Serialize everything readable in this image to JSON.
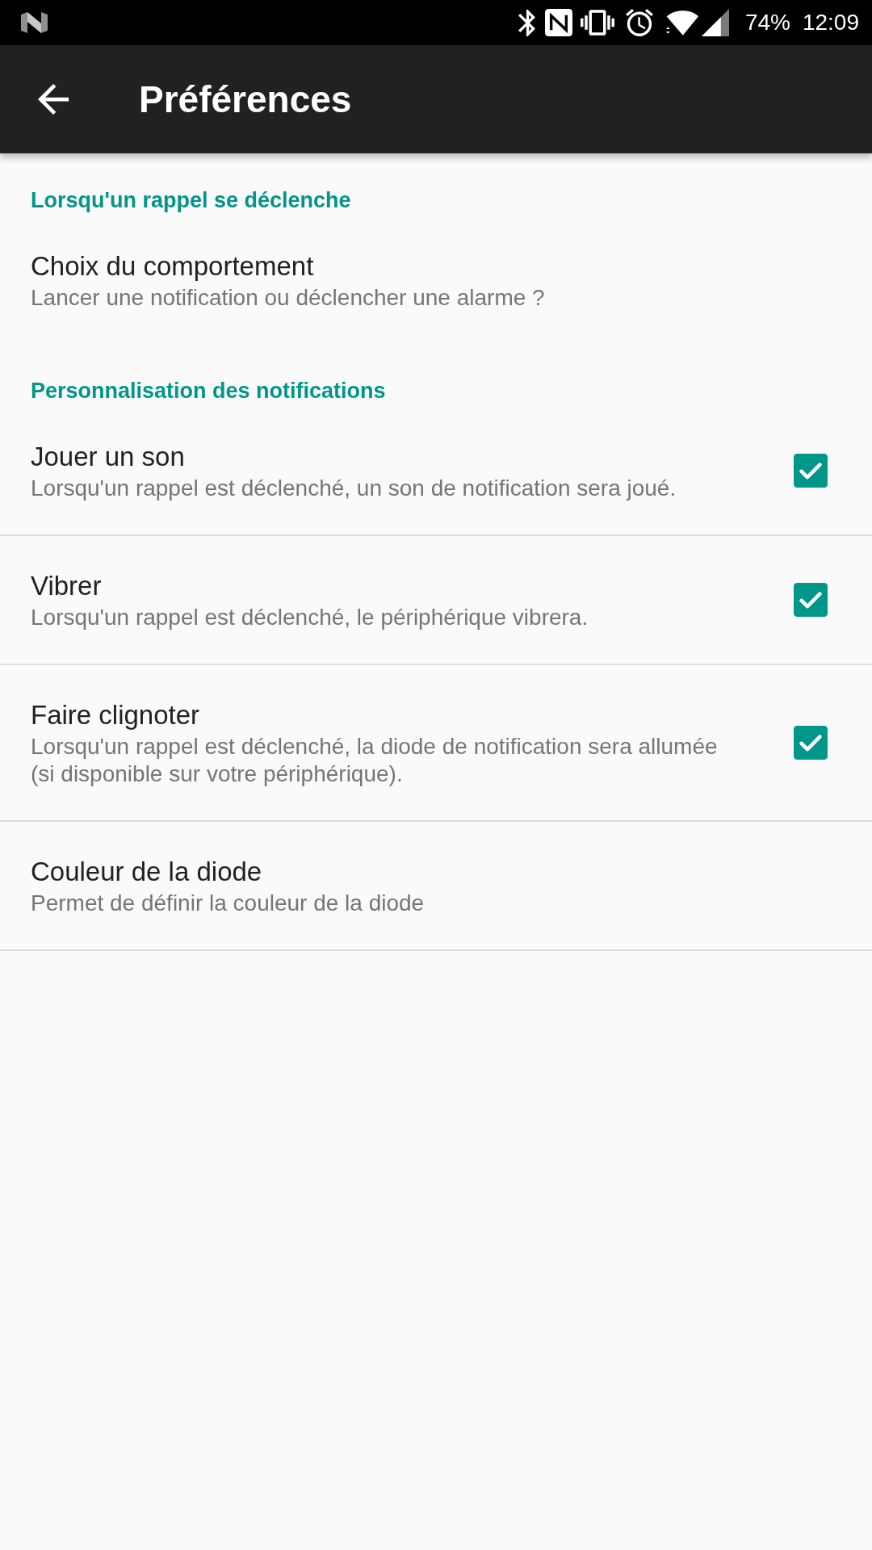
{
  "status_bar": {
    "battery": "74%",
    "time": "12:09"
  },
  "app_bar": {
    "title": "Préférences"
  },
  "sections": [
    {
      "header": "Lorsqu'un rappel se déclenche",
      "kind": "plain",
      "items": [
        {
          "kind": "plain",
          "title": "Choix du comportement",
          "summary": "Lancer une notification ou déclencher une alarme ?"
        }
      ]
    },
    {
      "header": "Personnalisation des notifications",
      "kind": "divided",
      "items": [
        {
          "kind": "checkbox",
          "title": "Jouer un son",
          "summary": "Lorsqu'un rappel est déclenché, un son de notification sera joué.",
          "checked": true
        },
        {
          "kind": "checkbox",
          "title": "Vibrer",
          "summary": "Lorsqu'un rappel est déclenché, le périphérique vibrera.",
          "checked": true
        },
        {
          "kind": "checkbox",
          "title": "Faire clignoter",
          "summary": "Lorsqu'un rappel est déclenché, la diode de notification sera allumée (si disponible sur votre périphérique).",
          "checked": true
        },
        {
          "kind": "plain",
          "title": "Couleur de la diode",
          "summary": "Permet de définir la couleur de la diode"
        }
      ]
    }
  ]
}
